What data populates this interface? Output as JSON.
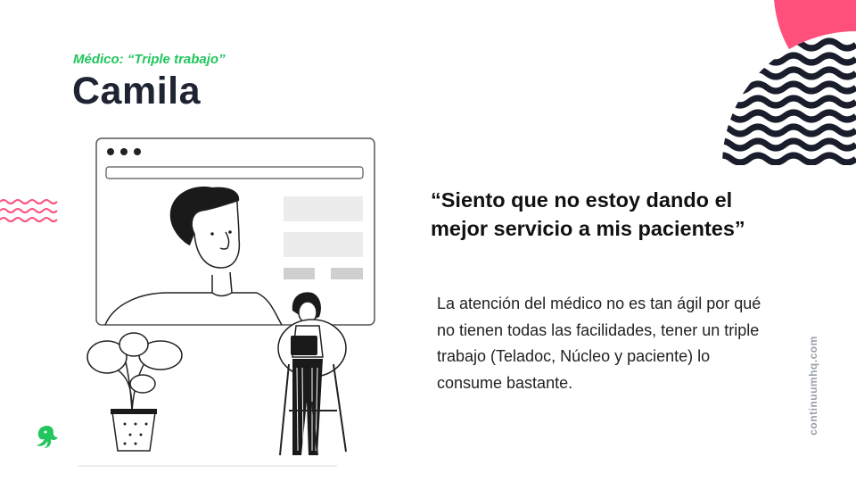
{
  "slide": {
    "subtitle": "Médico: “Triple trabajo”",
    "title": "Camila",
    "quote": "“Siento que no estoy dando el mejor servicio a mis pacientes”",
    "body": "La atención del médico no es tan ágil por qué no tienen todas las facilidades, tener un triple trabajo (Teladoc, Núcleo y paciente) lo consume bastante.",
    "brand_url": "continuumhq.com"
  },
  "colors": {
    "accent_green": "#22c55e",
    "accent_pink": "#ff4f7b",
    "dark_navy": "#1f2433",
    "wave_dark": "#1a1d2b",
    "muted_gray": "#9aa0a8"
  },
  "icons": [
    "browser-window-illustration",
    "person-on-stool-illustration",
    "potted-plant-illustration",
    "wave-decoration",
    "continuum-logo-icon"
  ]
}
